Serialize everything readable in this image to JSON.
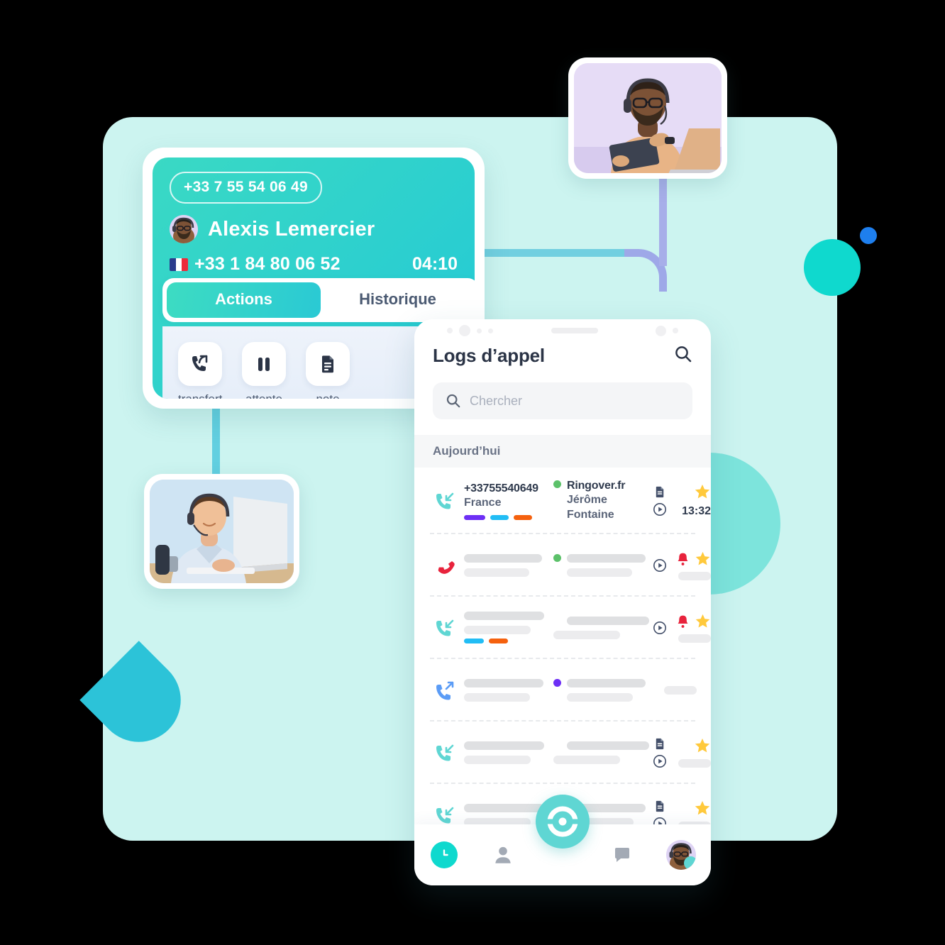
{
  "colors": {
    "background_panel": "#ccf4f0",
    "accent_teal": "#0fd9ce",
    "accent_blue": "#1e7fee",
    "card_gradient_from": "#3ad9c4",
    "card_gradient_to": "#23c9d6",
    "fab": "#5fd6d3",
    "star": "#ffc93c",
    "bell": "#e8233c"
  },
  "call_card": {
    "dialed_number_pill": "+33 7 55 54 06 49",
    "caller_name": "Alexis Lemercier",
    "caller_number": "+33 1 84 80 06 52",
    "country_flag": "france-flag-icon",
    "call_timer": "04:10",
    "tabs": [
      {
        "label": "Actions",
        "active": true
      },
      {
        "label": "Historique",
        "active": false
      }
    ],
    "actions": [
      {
        "icon": "call-transfer-icon",
        "label": "transfert"
      },
      {
        "icon": "pause-icon",
        "label": "attente"
      },
      {
        "icon": "note-document-icon",
        "label": "note"
      }
    ]
  },
  "phone": {
    "title": "Logs d’appel",
    "header_search_icon": "search-icon",
    "search": {
      "icon": "search-icon",
      "placeholder": "Chercher",
      "value": ""
    },
    "section_label": "Aujourd’hui",
    "rows": [
      {
        "direction_icon": "call-incoming-icon",
        "direction_color": "#5fd6d3",
        "number": "+33755540649",
        "country": "France",
        "status_dot": "#5cc16a",
        "contact_site": "Ringover.fr",
        "contact_name": "Jérôme Fontaine",
        "tags": [
          "#6d2ff5",
          "#22bdf5",
          "#f5610e"
        ],
        "has_note": true,
        "has_play": true,
        "has_bell": false,
        "has_star": true,
        "time": "13:32",
        "placeholder": false
      },
      {
        "direction_icon": "call-missed-icon",
        "direction_color": "#e8233c",
        "number": "",
        "country": "",
        "status_dot": "#5cc16a",
        "contact_site": "",
        "contact_name": "",
        "tags": [],
        "has_note": false,
        "has_play": true,
        "has_bell": true,
        "has_star": true,
        "time": "",
        "placeholder": true
      },
      {
        "direction_icon": "call-incoming-icon",
        "direction_color": "#5fd6d3",
        "number": "",
        "country": "",
        "status_dot": "",
        "contact_site": "",
        "contact_name": "",
        "tags": [
          "#22bdf5",
          "#f5610e"
        ],
        "has_note": false,
        "has_play": true,
        "has_bell": true,
        "has_star": true,
        "time": "",
        "placeholder": true
      },
      {
        "direction_icon": "call-outgoing-icon",
        "direction_color": "#5b9cf6",
        "number": "",
        "country": "",
        "status_dot": "#6d2ff5",
        "contact_site": "",
        "contact_name": "",
        "tags": [],
        "has_note": false,
        "has_play": false,
        "has_bell": false,
        "has_star": false,
        "time": "",
        "placeholder": true
      },
      {
        "direction_icon": "call-incoming-icon",
        "direction_color": "#5fd6d3",
        "number": "",
        "country": "",
        "status_dot": "",
        "contact_site": "",
        "contact_name": "",
        "tags": [],
        "has_note": true,
        "has_play": true,
        "has_bell": false,
        "has_star": true,
        "time": "",
        "placeholder": true
      },
      {
        "direction_icon": "call-incoming-icon",
        "direction_color": "#5fd6d3",
        "number": "",
        "country": "",
        "status_dot": "#5cc16a",
        "contact_site": "",
        "contact_name": "",
        "tags": [],
        "has_note": true,
        "has_play": true,
        "has_bell": false,
        "has_star": true,
        "time": "",
        "placeholder": true
      }
    ],
    "tabbar": [
      {
        "icon": "clock-history-icon",
        "active": true
      },
      {
        "icon": "contacts-person-icon",
        "active": false
      },
      {
        "icon": "ringover-dial-icon",
        "active": false,
        "is_fab": true
      },
      {
        "icon": "chat-bubble-icon",
        "active": false
      },
      {
        "icon": "user-avatar-icon",
        "active": false
      }
    ]
  },
  "photos": [
    {
      "name": "agent-with-laptop-photo",
      "alt": "Agent with headset using laptop and tablet"
    },
    {
      "name": "agent-at-desktop-photo",
      "alt": "Agent with headset at desktop computer"
    }
  ]
}
